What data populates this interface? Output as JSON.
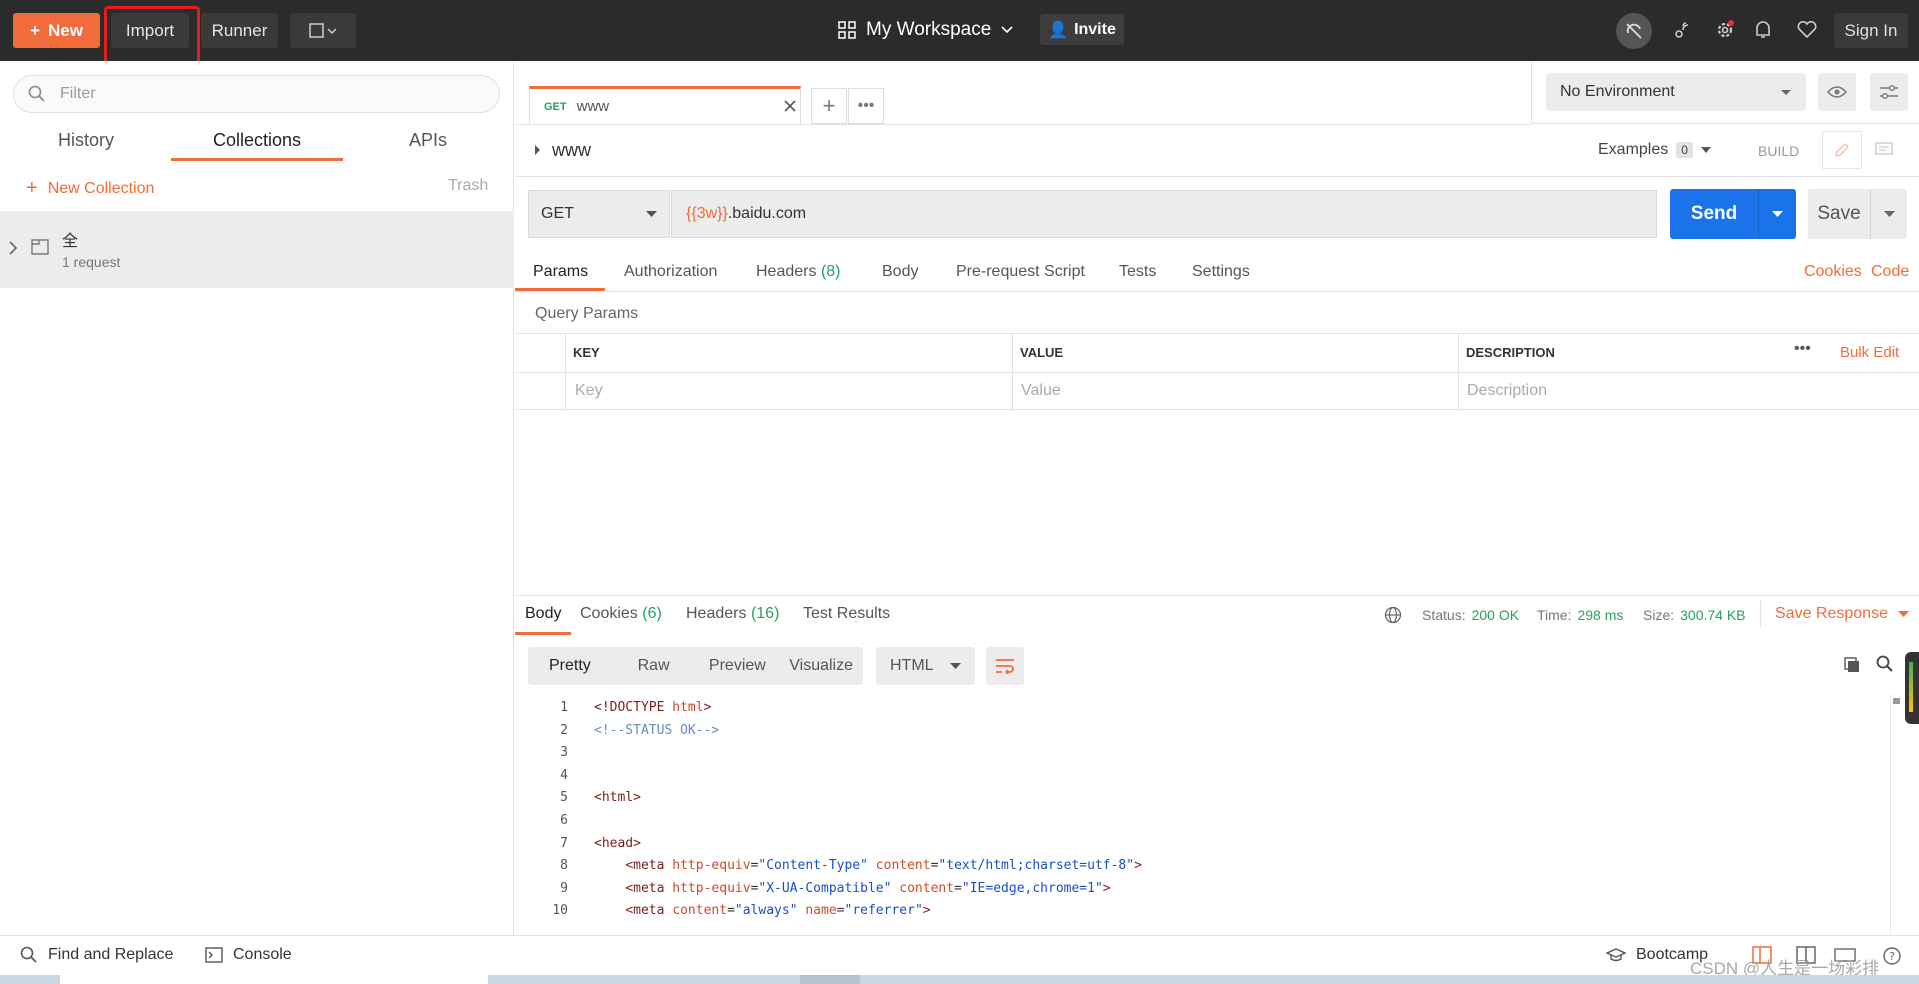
{
  "topbar": {
    "new_label": "New",
    "import_label": "Import",
    "runner_label": "Runner",
    "workspace_label": "My Workspace",
    "invite_label": "Invite",
    "signin_label": "Sign In"
  },
  "sidebar": {
    "filter_placeholder": "Filter",
    "tabs": [
      "History",
      "Collections",
      "APIs"
    ],
    "new_collection_label": "New Collection",
    "trash_label": "Trash",
    "collection": {
      "name": "全",
      "meta": "1 request"
    }
  },
  "request_tab": {
    "method": "GET",
    "name": "www"
  },
  "environment": {
    "selected": "No Environment"
  },
  "request_header": {
    "name": "www",
    "examples_label": "Examples",
    "examples_count": "0",
    "build_label": "BUILD"
  },
  "url_bar": {
    "method": "GET",
    "url_var": "{{3w}}",
    "url_rest": ".baidu.com",
    "send_label": "Send",
    "save_label": "Save"
  },
  "request_tabs": [
    {
      "label": "Params"
    },
    {
      "label": "Authorization"
    },
    {
      "label": "Headers",
      "count": "(8)"
    },
    {
      "label": "Body"
    },
    {
      "label": "Pre-request Script"
    },
    {
      "label": "Tests"
    },
    {
      "label": "Settings"
    }
  ],
  "request_links": {
    "cookies": "Cookies",
    "code": "Code"
  },
  "query_params": {
    "title": "Query Params",
    "headers": [
      "KEY",
      "VALUE",
      "DESCRIPTION"
    ],
    "placeholders": [
      "Key",
      "Value",
      "Description"
    ],
    "bulk_edit": "Bulk Edit"
  },
  "response": {
    "tabs": [
      {
        "label": "Body"
      },
      {
        "label": "Cookies",
        "count": "(6)"
      },
      {
        "label": "Headers",
        "count": "(16)"
      },
      {
        "label": "Test Results"
      }
    ],
    "status_label": "Status:",
    "status_value": "200 OK",
    "time_label": "Time:",
    "time_value": "298 ms",
    "size_label": "Size:",
    "size_value": "300.74 KB",
    "save_response_label": "Save Response",
    "views": [
      "Pretty",
      "Raw",
      "Preview",
      "Visualize"
    ],
    "format": "HTML"
  },
  "code_lines": [
    {
      "n": "1",
      "t": "<!DOCTYPE html>"
    },
    {
      "n": "2",
      "t": "<!--STATUS OK-->"
    },
    {
      "n": "3",
      "t": ""
    },
    {
      "n": "4",
      "t": ""
    },
    {
      "n": "5",
      "t": "<html>"
    },
    {
      "n": "6",
      "t": ""
    },
    {
      "n": "7",
      "t": "<head>"
    },
    {
      "n": "8",
      "t": "    <meta http-equiv=\"Content-Type\" content=\"text/html;charset=utf-8\">"
    },
    {
      "n": "9",
      "t": "    <meta http-equiv=\"X-UA-Compatible\" content=\"IE=edge,chrome=1\">"
    },
    {
      "n": "10",
      "t": "    <meta content=\"always\" name=\"referrer\">"
    }
  ],
  "footer": {
    "find_replace": "Find and Replace",
    "console": "Console",
    "bootcamp": "Bootcamp",
    "watermark": "CSDN @人生是一场彩排"
  },
  "colors": {
    "accent": "#f26b3a",
    "primary": "#1a73e8",
    "success": "#25a162"
  }
}
